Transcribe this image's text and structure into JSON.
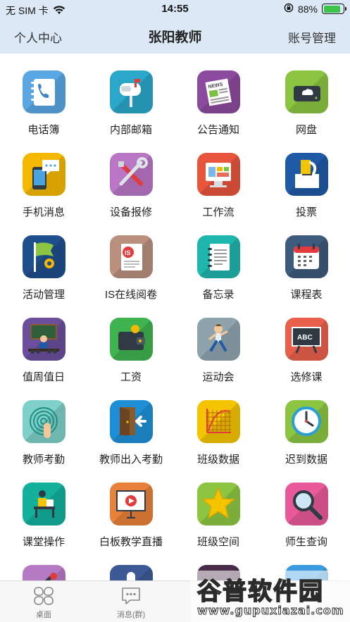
{
  "status_bar": {
    "carrier": "无 SIM 卡",
    "time": "14:55",
    "battery": "88%",
    "battery_level": 0.88,
    "icons": [
      "wifi-icon",
      "orientation-lock-icon",
      "battery-icon"
    ]
  },
  "nav": {
    "left": "个人中心",
    "title": "张阳教师",
    "right": "账号管理"
  },
  "apps": [
    {
      "label": "电话簿",
      "icon": "phonebook-icon",
      "color": "#5aa7e3"
    },
    {
      "label": "内部邮箱",
      "icon": "mailbox-icon",
      "color": "#2aa7c9"
    },
    {
      "label": "公告通知",
      "icon": "newspaper-icon",
      "color": "#8c4a9e"
    },
    {
      "label": "网盘",
      "icon": "cloud-drive-icon",
      "color": "#8bc541"
    },
    {
      "label": "手机消息",
      "icon": "phone-message-icon",
      "color": "#f5b800"
    },
    {
      "label": "设备报修",
      "icon": "repair-tools-icon",
      "color": "#b976c4"
    },
    {
      "label": "工作流",
      "icon": "workflow-icon",
      "color": "#e8553d"
    },
    {
      "label": "投票",
      "icon": "vote-box-icon",
      "color": "#1f5aa6"
    },
    {
      "label": "活动管理",
      "icon": "flag-gear-icon",
      "color": "#1f4e8c"
    },
    {
      "label": "IS在线阅卷",
      "icon": "document-is-icon",
      "color": "#b98f7e"
    },
    {
      "label": "备忘录",
      "icon": "notebook-icon",
      "color": "#1fb6ae"
    },
    {
      "label": "课程表",
      "icon": "calendar-icon",
      "color": "#3e5a7c"
    },
    {
      "label": "值周值日",
      "icon": "duty-presenter-icon",
      "color": "#6b4f9c"
    },
    {
      "label": "工资",
      "icon": "wallet-icon",
      "color": "#3fb34f"
    },
    {
      "label": "运动会",
      "icon": "runner-icon",
      "color": "#8fa3ad"
    },
    {
      "label": "选修课",
      "icon": "blackboard-abc-icon",
      "color": "#e8604c"
    },
    {
      "label": "教师考勤",
      "icon": "fingerprint-icon",
      "color": "#7fd0c8"
    },
    {
      "label": "教师出入考勤",
      "icon": "door-exit-icon",
      "color": "#1e8fd6"
    },
    {
      "label": "班级数据",
      "icon": "chart-grid-icon",
      "color": "#f5c400"
    },
    {
      "label": "迟到数据",
      "icon": "clock-icon",
      "color": "#8bc541"
    },
    {
      "label": "课堂操作",
      "icon": "teacher-desk-icon",
      "color": "#13b09c"
    },
    {
      "label": "白板教学直播",
      "icon": "whiteboard-play-icon",
      "color": "#e8823a"
    },
    {
      "label": "班级空间",
      "icon": "star-icon",
      "color": "#8bc541"
    },
    {
      "label": "师生查询",
      "icon": "magnifier-icon",
      "color": "#e85a9a"
    },
    {
      "label": "",
      "icon": "partial-tools-icon",
      "color": "#b57ac4"
    },
    {
      "label": "",
      "icon": "partial-microphone-icon",
      "color": "#3e5a96"
    },
    {
      "label": "",
      "icon": "partial-app-icon",
      "color": "#4a2b48"
    },
    {
      "label": "",
      "icon": "partial-app-icon",
      "color": "#3a9be0"
    }
  ],
  "tabs": [
    {
      "label": "桌面",
      "icon": "desktop-grid-icon"
    },
    {
      "label": "消息(群)",
      "icon": "message-bubble-icon"
    },
    {
      "label": "",
      "icon": "tab-icon"
    },
    {
      "label": "",
      "icon": "tab-icon"
    }
  ],
  "watermark": {
    "main": "谷普软件园",
    "sub": "www.gupuxiazai.com"
  }
}
